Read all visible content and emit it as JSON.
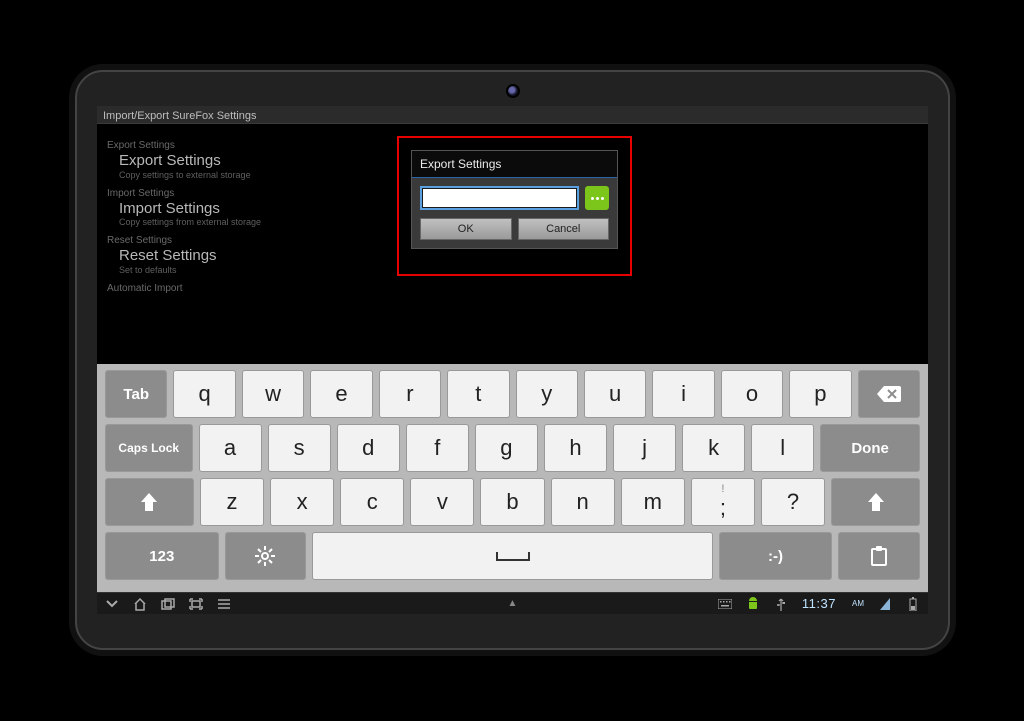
{
  "app": {
    "title": "Import/Export SureFox Settings"
  },
  "settings": {
    "sections": [
      {
        "head": "Export Settings",
        "item": {
          "title": "Export Settings",
          "sub": "Copy settings to external storage"
        }
      },
      {
        "head": "Import Settings",
        "item": {
          "title": "Import Settings",
          "sub": "Copy settings from external storage"
        }
      },
      {
        "head": "Reset Settings",
        "item": {
          "title": "Reset Settings",
          "sub": "Set to defaults"
        }
      },
      {
        "head": "Automatic Import",
        "item": null
      }
    ]
  },
  "dialog": {
    "title": "Export Settings",
    "path_value": "",
    "ok": "OK",
    "cancel": "Cancel"
  },
  "keyboard": {
    "tab": "Tab",
    "caps": "Caps Lock",
    "done": "Done",
    "sym": "123",
    "smile": ":-)",
    "row1": [
      "q",
      "w",
      "e",
      "r",
      "t",
      "y",
      "u",
      "i",
      "o",
      "p"
    ],
    "row2": [
      "a",
      "s",
      "d",
      "f",
      "g",
      "h",
      "j",
      "k",
      "l"
    ],
    "row3": [
      "z",
      "x",
      "c",
      "v",
      "b",
      "n",
      "m",
      ";",
      "?"
    ],
    "row3alt": [
      "",
      "",
      "",
      "",
      "",
      "",
      "",
      "!",
      ""
    ]
  },
  "status": {
    "time": "11:37",
    "ampm": "AM"
  }
}
